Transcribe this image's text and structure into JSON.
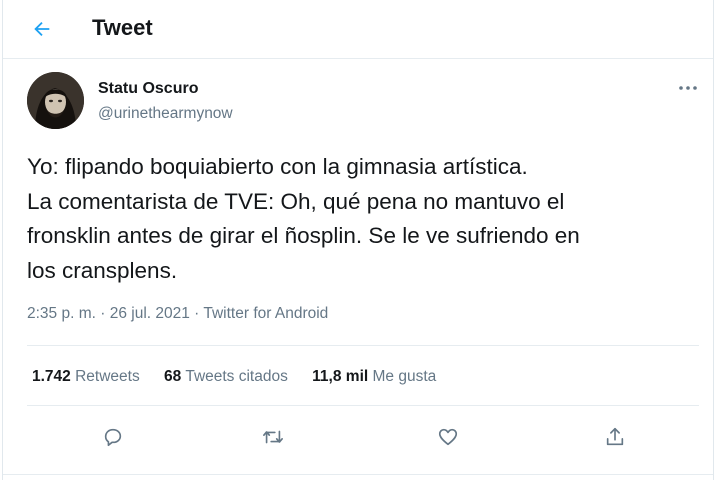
{
  "header": {
    "title": "Tweet",
    "back_icon": "arrow-left-icon"
  },
  "tweet": {
    "display_name": "Statu Oscuro",
    "handle": "@urinethearmynow",
    "text_lines": [
      "Yo: flipando boquiabierto con la gimnasia artística.",
      "La comentarista de TVE: Oh, qué pena no mantuvo el",
      "fronsklin antes de girar el ñosplin. Se le ve sufriendo en",
      "los cransplens."
    ],
    "time": "2:35 p. m.",
    "separator": " · ",
    "date": "26 jul. 2021",
    "source": "Twitter for Android"
  },
  "stats": {
    "retweets": {
      "count": "1.742",
      "label": "Retweets"
    },
    "quotes": {
      "count": "68",
      "label": "Tweets citados"
    },
    "likes": {
      "count": "11,8 mil",
      "label": "Me gusta"
    }
  },
  "actions": [
    "reply-icon",
    "retweet-icon",
    "like-icon",
    "share-icon"
  ],
  "colors": {
    "accent": "#1da1f2",
    "secondary_text": "#657786",
    "divider": "#e6ecf0"
  }
}
